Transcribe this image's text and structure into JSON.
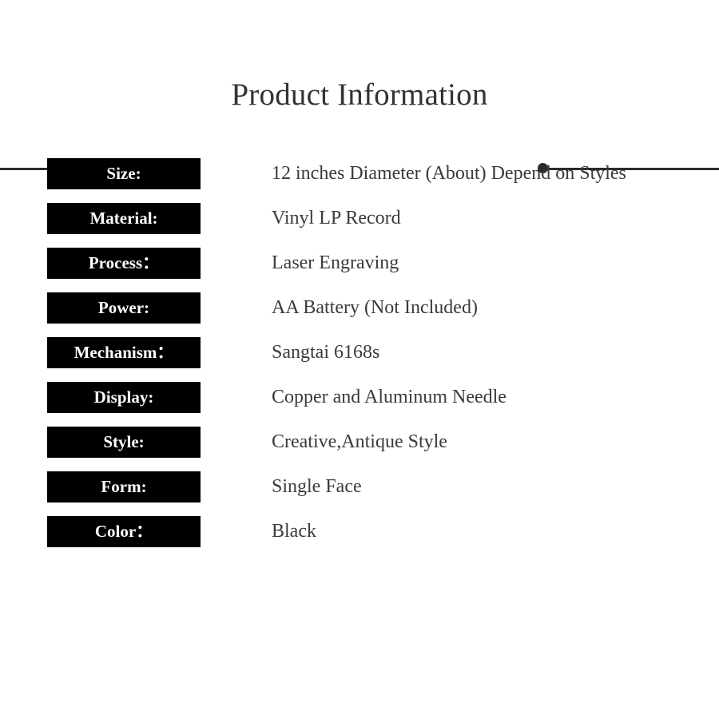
{
  "header": {
    "title": "Product Information",
    "left_dot": "bullet-dot",
    "right_dot": "bullet-dot",
    "rule_color": "#2b2b2b",
    "title_color": "#333333"
  },
  "spec_table": {
    "label_background": "#000000",
    "label_color": "#ffffff",
    "value_color": "#3a3a3a",
    "rows": [
      {
        "label": "Size:",
        "value": "12 inches Diameter (About) Depend on Styles"
      },
      {
        "label": "Material:",
        "value": "Vinyl LP Record"
      },
      {
        "label": "Process：",
        "value": "Laser Engraving"
      },
      {
        "label": "Power:",
        "value": "AA Battery (Not Included)"
      },
      {
        "label": "Mechanism：",
        "value": "Sangtai 6168s"
      },
      {
        "label": "Display:",
        "value": "Copper and Aluminum Needle"
      },
      {
        "label": "Style:",
        "value": "Creative,Antique Style"
      },
      {
        "label": "Form:",
        "value": "Single Face"
      },
      {
        "label": "Color：",
        "value": "Black"
      }
    ]
  }
}
